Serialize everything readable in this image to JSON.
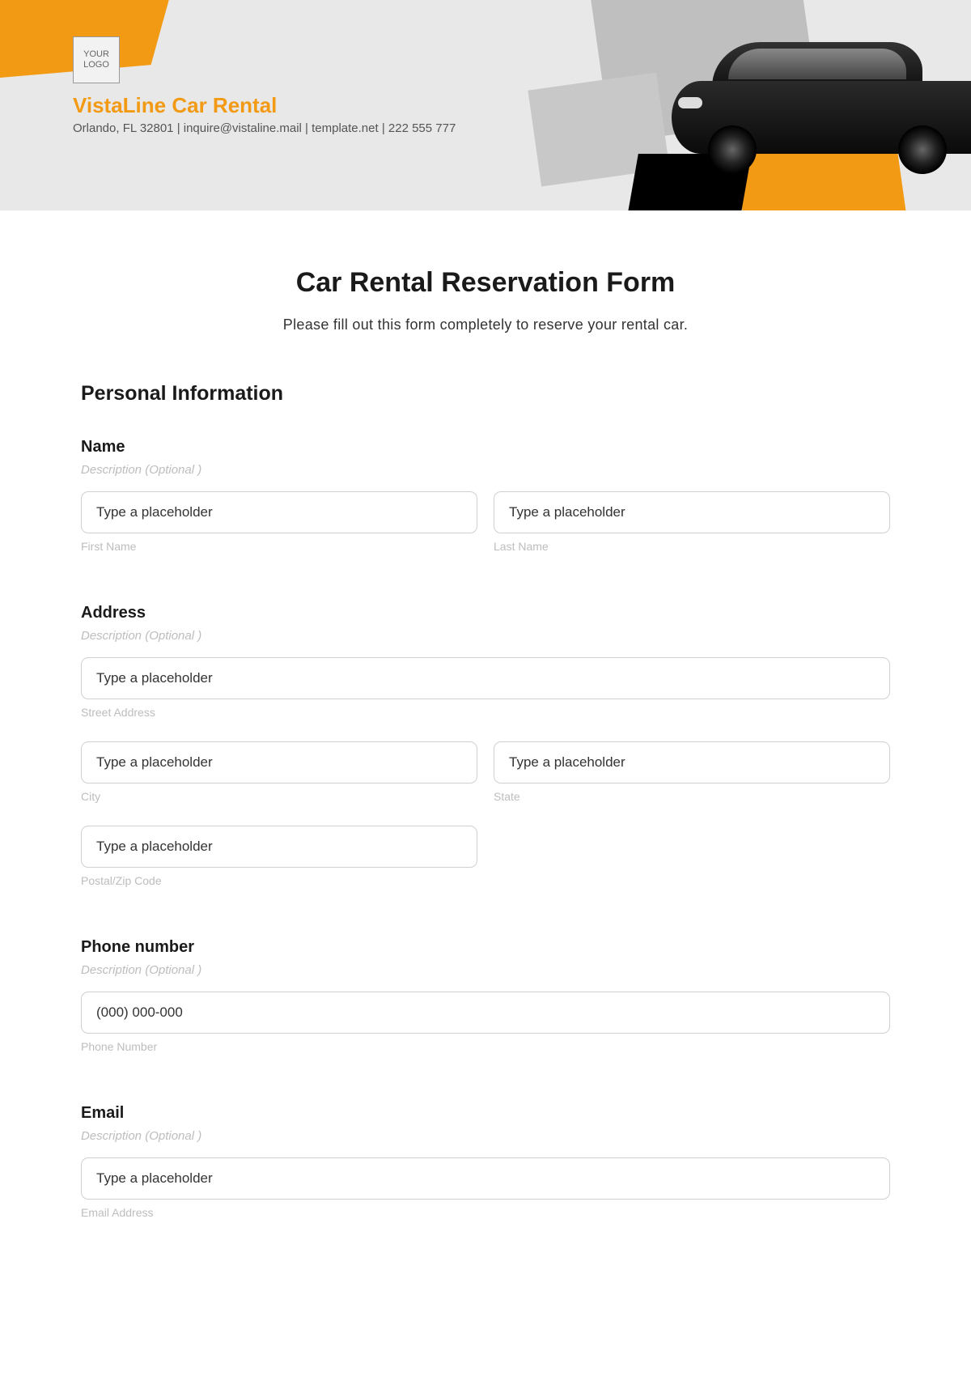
{
  "header": {
    "logo_text": "YOUR LOGO",
    "company_name": "VistaLine Car Rental",
    "company_info": "Orlando, FL 32801 | inquire@vistaline.mail | template.net | 222 555 777"
  },
  "form": {
    "title": "Car Rental Reservation Form",
    "subtitle": "Please fill out this form completely to reserve your rental car.",
    "section_personal": "Personal Information",
    "desc_optional": "Description  (Optional )",
    "name": {
      "label": "Name",
      "first_placeholder": "Type a placeholder",
      "last_placeholder": "Type a placeholder",
      "first_sublabel": "First Name",
      "last_sublabel": "Last Name"
    },
    "address": {
      "label": "Address",
      "street_placeholder": "Type a placeholder",
      "street_sublabel": "Street Address",
      "city_placeholder": "Type a placeholder",
      "city_sublabel": "City",
      "state_placeholder": "Type a placeholder",
      "state_sublabel": "State",
      "postal_placeholder": "Type a placeholder",
      "postal_sublabel": "Postal/Zip Code"
    },
    "phone": {
      "label": "Phone number",
      "placeholder": "(000) 000-000",
      "sublabel": "Phone Number"
    },
    "email": {
      "label": "Email",
      "placeholder": "Type a placeholder",
      "sublabel": "Email Address"
    }
  }
}
